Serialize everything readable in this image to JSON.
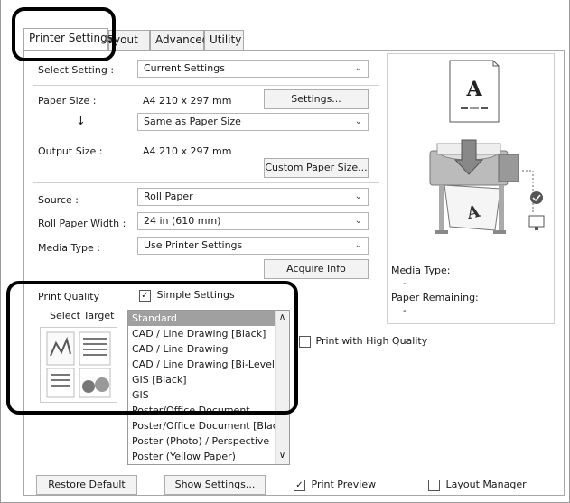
{
  "tabs": [
    {
      "label": "Printer Settings"
    },
    {
      "label": "Layout"
    },
    {
      "label": "Advanced"
    },
    {
      "label": "Utility"
    }
  ],
  "form": {
    "select_setting_label": "Select Setting :",
    "select_setting_value": "Current Settings",
    "paper_size_label": "Paper Size :",
    "paper_size_value": "A4 210 x 297 mm",
    "settings_button": "Settings...",
    "arrow_glyph": "↓",
    "same_as_value": "Same as Paper Size",
    "output_size_label": "Output Size :",
    "output_size_value": "A4 210 x 297 mm",
    "custom_paper_button": "Custom Paper Size...",
    "source_label": "Source :",
    "source_value": "Roll Paper",
    "roll_width_label": "Roll Paper Width :",
    "roll_width_value": "24 in (610 mm)",
    "media_type_label": "Media Type :",
    "media_type_value": "Use Printer Settings",
    "acquire_button": "Acquire Info"
  },
  "preview": {
    "paper_letter": "A",
    "media_type_label": "Media Type:",
    "media_type_value": "-",
    "paper_remaining_label": "Paper Remaining:",
    "paper_remaining_value": "-"
  },
  "quality": {
    "label": "Print Quality",
    "simple_settings_label": "Simple Settings",
    "simple_settings_checked": true,
    "select_target_label": "Select Target",
    "targets": [
      "Standard",
      "CAD / Line Drawing [Black]",
      "CAD / Line Drawing",
      "CAD / Line Drawing [Bi-Level]",
      "GIS [Black]",
      "GIS",
      "Poster/Office Document",
      "Poster/Office Document [Black]",
      "Poster (Photo) / Perspective",
      "Poster (Yellow Paper)"
    ],
    "selected_index": 0,
    "high_quality_label": "Print with High Quality"
  },
  "footer": {
    "restore_button": "Restore Default",
    "show_settings_button": "Show Settings...",
    "print_preview_label": "Print Preview",
    "print_preview_checked": true,
    "layout_manager_label": "Layout Manager",
    "layout_manager_checked": false
  },
  "icons": {
    "checkmark": "✓",
    "chevron_down": "⌄",
    "scroll_up": "∧",
    "scroll_down": "∨"
  }
}
